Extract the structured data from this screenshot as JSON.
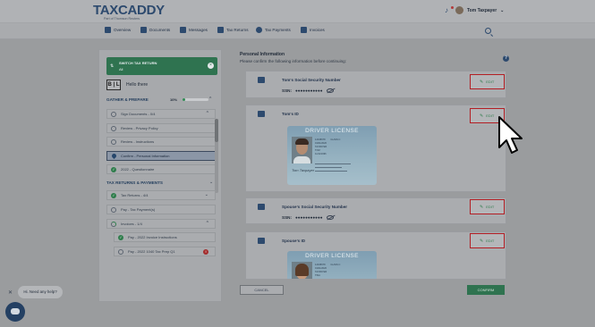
{
  "brand": {
    "logo_text": "TAXCADDY",
    "tagline": "Part of Thomson Reuters"
  },
  "header": {
    "user_name": "Tom Taxpayer",
    "user_caret": "⌄"
  },
  "nav": [
    {
      "label": "Overview",
      "icon": "home-icon"
    },
    {
      "label": "Documents",
      "icon": "folder-icon"
    },
    {
      "label": "Messages",
      "icon": "message-icon"
    },
    {
      "label": "Tax Returns",
      "icon": "tax-return-icon"
    },
    {
      "label": "Tax Payments",
      "icon": "dollar-icon"
    },
    {
      "label": "Invoices",
      "icon": "invoice-icon"
    }
  ],
  "sidebar": {
    "switch": {
      "title": "SWITCH TAX RETURN",
      "value": "All"
    },
    "badge_initials": "B | L",
    "greeting": "Hello there",
    "gather": {
      "title": "GATHER & PREPARE",
      "progress_label": "10%",
      "progress": 0.1
    },
    "gather_items": [
      {
        "label": "Sign Documents - 0/4",
        "state": "empty",
        "chevron": "^"
      },
      {
        "label": "Review - Privacy Policy",
        "state": "empty"
      },
      {
        "label": "Review - Instructions",
        "state": "empty"
      },
      {
        "label": "Confirm - Personal Information",
        "state": "active"
      },
      {
        "label": "2022 - Questionnaire",
        "state": "check"
      }
    ],
    "returns": {
      "title": "TAX RETURNS & PAYMENTS"
    },
    "returns_items": [
      {
        "label": "Tax Returns - 4/4",
        "state": "check",
        "chevron": "⌄"
      },
      {
        "label": "Pay - Tax Payment(s)",
        "state": "empty"
      },
      {
        "label": "Invoices - 1/4",
        "state": "partial",
        "chevron": "^"
      },
      {
        "label": "Pay - 2022 Invoice Instructions",
        "state": "check"
      },
      {
        "label": "Pay - 2022 1040 Tax Prep Q1",
        "state": "empty",
        "badge": "!"
      }
    ]
  },
  "main": {
    "title": "Personal Information",
    "subtitle": "Please confirm the following information before continuing:",
    "cards": [
      {
        "title": "Tom's Social Security Number",
        "ssn_label": "SSN:",
        "ssn_value": "●●●●●●●●●●●"
      },
      {
        "title": "Tom's ID"
      },
      {
        "title": "Spouse's Social Security Number",
        "ssn_label": "SSN:",
        "ssn_value": "●●●●●●●●●●●"
      },
      {
        "title": "Spouse's ID"
      }
    ],
    "edit_label": "EDIT",
    "license": {
      "title": "DRIVER LICENSE",
      "class": "CLASS C",
      "dl": "12345678",
      "exp": "01/01/2026",
      "ln": "TAXPAYER",
      "fn": "TOM",
      "dob": "11/11/1996",
      "spouse_fn": "TINA",
      "signature": "Tom Taxpayer"
    },
    "cancel_label": "CANCEL",
    "confirm_label": "CONFIRM"
  },
  "chat": {
    "text": "Hi. Need any help?",
    "close": "✕"
  }
}
